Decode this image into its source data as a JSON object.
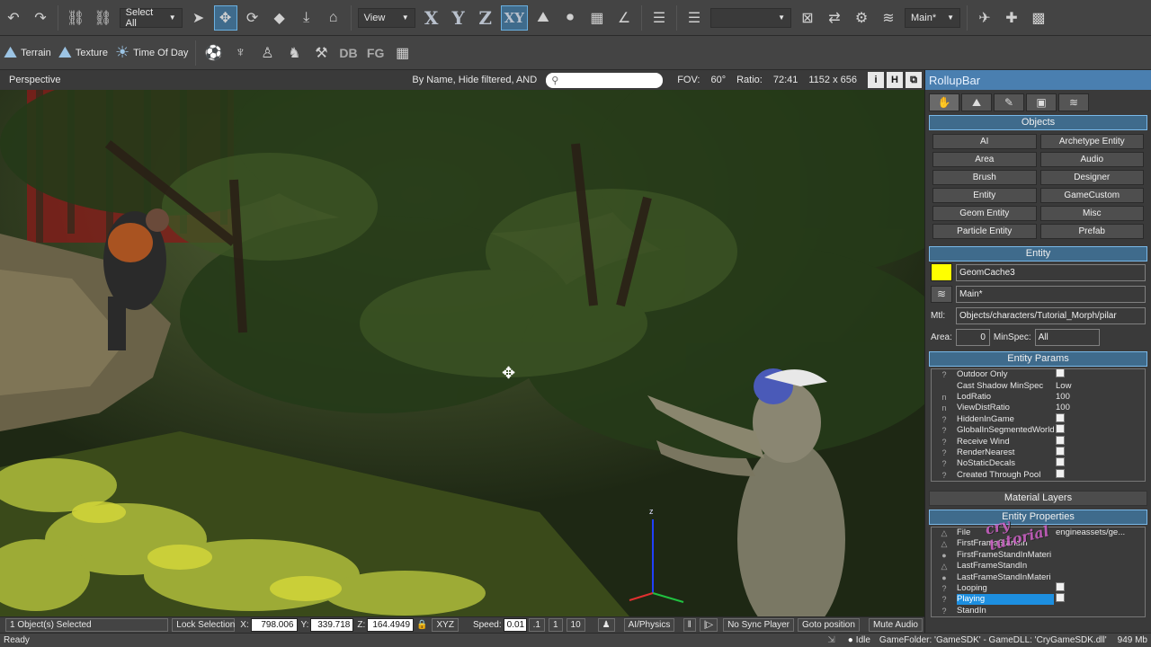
{
  "toolbar1": {
    "select_filter": "Select All",
    "view_dropdown": "View",
    "axis_x": "X",
    "axis_y": "Y",
    "axis_z": "Z",
    "axis_xy": "XY",
    "layer_dropdown": "Main*",
    "icons": [
      "undo-icon",
      "redo-icon",
      "link-icon",
      "unlink-icon",
      "select-arrow-icon",
      "move-icon",
      "rotate-icon",
      "scale-icon",
      "align-icon",
      "snap-icon",
      "grid-icon",
      "angle-icon",
      "terrain-snap-icon",
      "ruler-icon",
      "layer-icon",
      "camera-icon"
    ]
  },
  "toolbar2": {
    "terrain_label": "Terrain",
    "texture_label": "Texture",
    "time_of_day_label": "Time Of Day",
    "db_label": "DB",
    "fg_label": "FG"
  },
  "viewport": {
    "mode_label": "Perspective",
    "filter_label": "By Name, Hide filtered, AND",
    "fov_label": "FOV:",
    "fov_value": "60°",
    "ratio_label": "Ratio:",
    "ratio_value": "72:41",
    "resolution": "1152 x 656",
    "btn_i": "i",
    "btn_h": "H"
  },
  "rollup": {
    "title": "RollupBar",
    "objects_header": "Objects",
    "object_buttons": [
      "AI",
      "Archetype Entity",
      "Area",
      "Audio",
      "Brush",
      "Designer",
      "Entity",
      "GameCustom",
      "Geom Entity",
      "Misc",
      "Particle Entity",
      "Prefab"
    ],
    "entity_header": "Entity",
    "entity_name": "GeomCache3",
    "entity_layer": "Main*",
    "mtl_label": "Mtl:",
    "mtl_value": "Objects/characters/Tutorial_Morph/pilar",
    "area_label": "Area:",
    "area_value": "0",
    "minspec_label": "MinSpec:",
    "minspec_value": "All",
    "entity_params_header": "Entity Params",
    "entity_params": [
      {
        "icon": "?",
        "name": "Outdoor Only",
        "value": "",
        "check": true
      },
      {
        "icon": "",
        "name": "Cast Shadow MinSpec",
        "value": "Low",
        "check": false
      },
      {
        "icon": "n",
        "name": "LodRatio",
        "value": "100",
        "check": false
      },
      {
        "icon": "n",
        "name": "ViewDistRatio",
        "value": "100",
        "check": false
      },
      {
        "icon": "?",
        "name": "HiddenInGame",
        "value": "",
        "check": true
      },
      {
        "icon": "?",
        "name": "GlobalInSegmentedWorld",
        "value": "",
        "check": true
      },
      {
        "icon": "?",
        "name": "Receive Wind",
        "value": "",
        "check": true
      },
      {
        "icon": "?",
        "name": "RenderNearest",
        "value": "",
        "check": true
      },
      {
        "icon": "?",
        "name": "NoStaticDecals",
        "value": "",
        "check": true
      },
      {
        "icon": "?",
        "name": "Created Through Pool",
        "value": "",
        "check": true
      }
    ],
    "material_layers_header": "Material Layers",
    "entity_properties_header": "Entity Properties",
    "entity_properties": [
      {
        "icon": "△",
        "name": "File",
        "value": "engineassets/ge...",
        "check": false,
        "sel": false
      },
      {
        "icon": "△",
        "name": "FirstFrameStandIn",
        "value": "",
        "check": false,
        "sel": false
      },
      {
        "icon": "●",
        "name": "FirstFrameStandInMateri",
        "value": "",
        "check": false,
        "sel": false
      },
      {
        "icon": "△",
        "name": "LastFrameStandIn",
        "value": "",
        "check": false,
        "sel": false
      },
      {
        "icon": "●",
        "name": "LastFrameStandInMateri",
        "value": "",
        "check": false,
        "sel": false
      },
      {
        "icon": "?",
        "name": "Looping",
        "value": "",
        "check": true,
        "sel": false
      },
      {
        "icon": "?",
        "name": "Playing",
        "value": "",
        "check": true,
        "sel": true
      },
      {
        "icon": "?",
        "name": "StandIn",
        "value": "",
        "check": false,
        "sel": false
      }
    ]
  },
  "statusbar": {
    "selection": "1 Object(s) Selected",
    "lock_selection": "Lock Selection",
    "x_label": "X:",
    "x_value": "798.006",
    "y_label": "Y:",
    "y_value": "339.718",
    "z_label": "Z:",
    "z_value": "164.4949",
    "xyz_btn": "XYZ",
    "speed_label": "Speed:",
    "speed_value": "0.01",
    "speed_presets": [
      ".1",
      "1",
      "10"
    ],
    "ai_physics": "AI/Physics",
    "no_sync_player": "No Sync Player",
    "goto_position": "Goto position",
    "mute_audio": "Mute Audio"
  },
  "bottom": {
    "ready": "Ready",
    "idle": "Idle",
    "game_info": "GameFolder: 'GameSDK' - GameDLL: 'CryGameSDK.dll'",
    "memory": "949 Mb"
  },
  "watermark": {
    "line1": "cry",
    "line2": "tutorial"
  }
}
